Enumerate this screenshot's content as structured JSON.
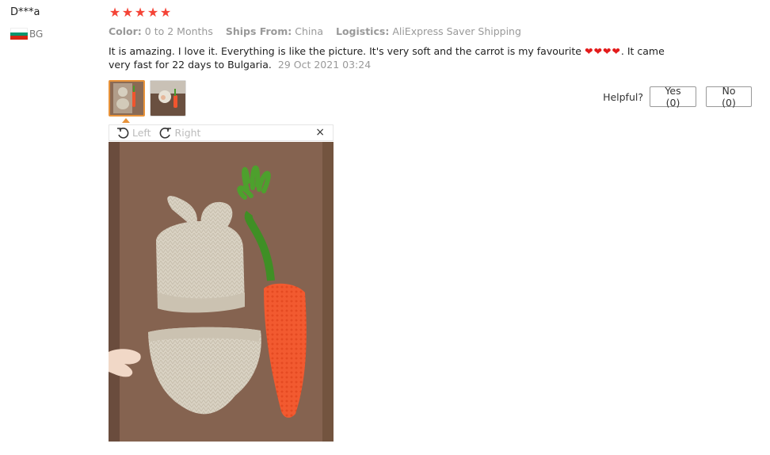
{
  "review": {
    "user": "D***a",
    "country_code": "BG",
    "rating": 5,
    "colors": {
      "star": "#f44336",
      "accent": "#e8933a",
      "heart": "#e31b1b"
    },
    "meta": {
      "color_label": "Color:",
      "color_value": "0 to 2 Months",
      "ships_label": "Ships From:",
      "ships_value": "China",
      "logistics_label": "Logistics:",
      "logistics_value": "AliExpress Saver Shipping"
    },
    "text_part1": "It is amazing. I love it. Everything is like the picture. It's very soft and the carrot is my favourite",
    "hearts": "❤❤❤❤",
    "text_part2": ". It came very fast for 22 days to Bulgaria.",
    "date": "29 Oct 2021 03:24"
  },
  "helpful": {
    "label": "Helpful?",
    "yes": "Yes (0)",
    "no": "No (0)"
  },
  "viewer": {
    "left_label": "Left",
    "right_label": "Right",
    "close": "×"
  }
}
